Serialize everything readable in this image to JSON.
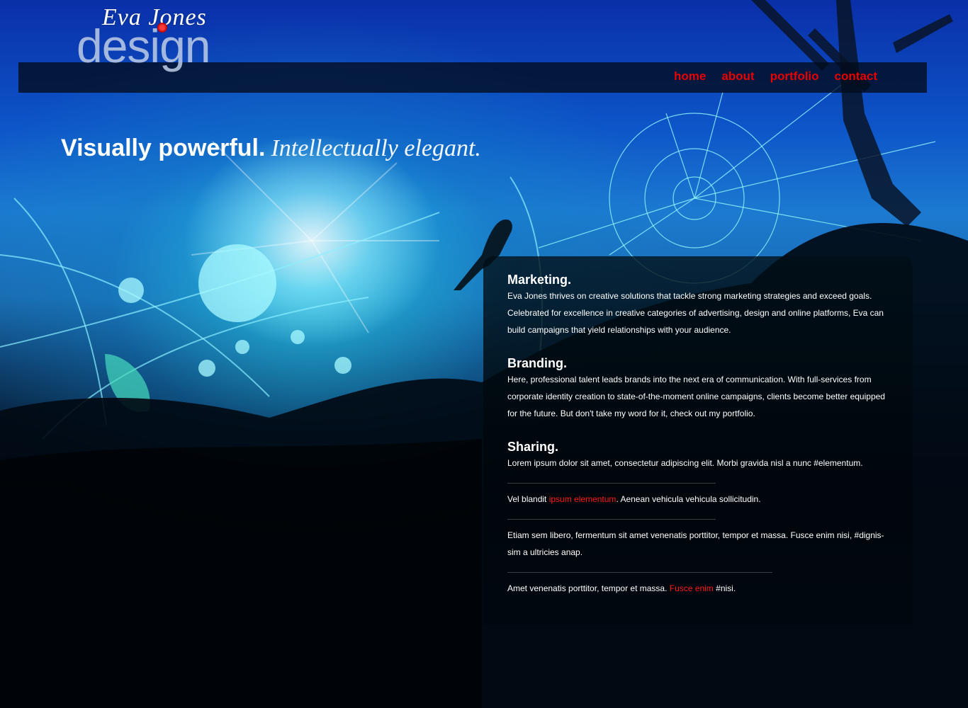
{
  "brand": {
    "script": "Eva Jones",
    "wordmark": "design"
  },
  "nav": {
    "items": [
      "home",
      "about",
      "portfolio",
      "contact"
    ]
  },
  "tagline": {
    "bold": "Visually powerful.",
    "script": "Intellectually elegant."
  },
  "sections": {
    "marketing": {
      "title": "Marketing.",
      "body": "Eva Jones thrives on creative solutions that tackle strong marketing strategies and exceed goals. Celebrated for excellence in creative categories of advertising, design and online platforms, Eva can build campaigns that yield relationships with your audience."
    },
    "branding": {
      "title": "Branding.",
      "body": "Here, professional talent leads brands into the next era of communication. With full-services from corporate identity creation to state-of-the-moment online campaigns, clients become better equipped for the future. But don't take my word for it, check out my portfolio."
    },
    "sharing": {
      "title": "Sharing.",
      "post1": "Lorem ipsum dolor sit amet, consectetur adipiscing elit. Morbi gravida nisl a nunc #elementum.",
      "post2_before": "Vel blandit ",
      "post2_link": "ipsum elementum",
      "post2_after": ". Aenean vehicula vehicula sollicitudin.",
      "post3": "Etiam sem libero, fermentum sit amet venenatis porttitor, tempor et massa. Fusce enim nisi, #dignis-sim a ultricies anap.",
      "post4_before": "Amet venenatis porttitor, tempor et massa. ",
      "post4_link": "Fusce enim",
      "post4_after": " #nisi."
    }
  },
  "colors": {
    "accent": "#e60000",
    "link": "#ff1a1a",
    "text": "#ffffff"
  }
}
